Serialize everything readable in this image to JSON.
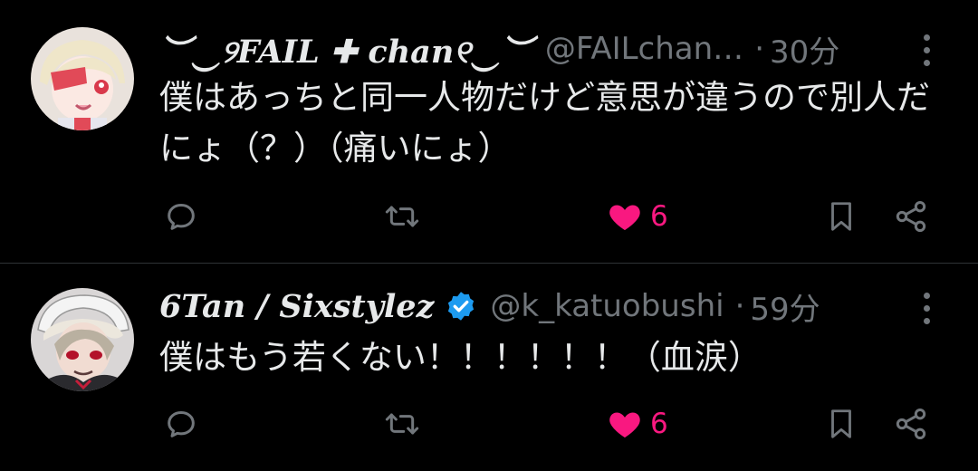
{
  "colors": {
    "background": "#000000",
    "text": "#e7e9ea",
    "muted": "#71767b",
    "like": "#f91880",
    "verified": "#1d9bf0"
  },
  "tweets": [
    {
      "display_name": "︶‿୨FAIL ✚ chan୧‿︶",
      "handle": "@FAILchan…",
      "separator": "·",
      "time": "30分",
      "text": "僕はあっちと同一人物だけど意思が違うので別人だにょ（？）（痛いにょ）",
      "verified": false,
      "likes": "6",
      "liked": true,
      "icons": [
        "reply-icon",
        "retweet-icon",
        "heart-icon",
        "bookmark-icon",
        "share-icon",
        "more-icon"
      ]
    },
    {
      "display_name": "6Tan / Sixstylez",
      "handle": "@k_katuobushi",
      "separator": "·",
      "time": "59分",
      "text": "僕はもう若くない！！！！！！（血涙）",
      "verified": true,
      "likes": "6",
      "liked": true,
      "icons": [
        "reply-icon",
        "retweet-icon",
        "heart-icon",
        "bookmark-icon",
        "share-icon",
        "more-icon"
      ]
    }
  ]
}
